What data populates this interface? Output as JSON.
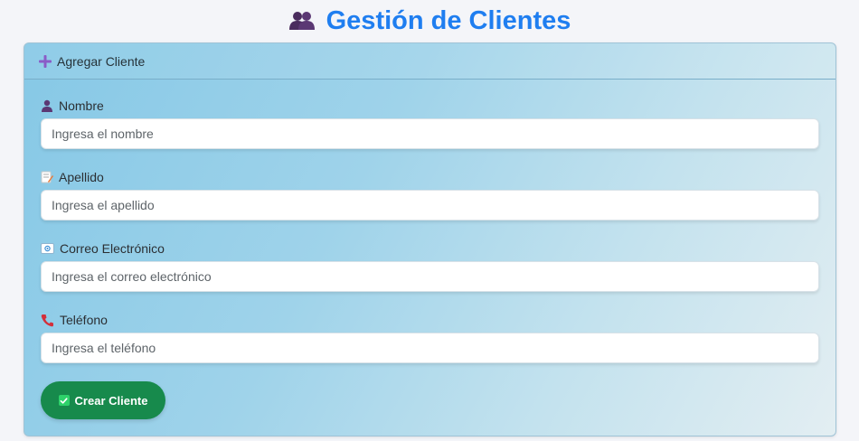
{
  "title": {
    "text": "Gestión de Clientes",
    "icon": "users-icon"
  },
  "card": {
    "header_label": "Agregar Cliente",
    "header_icon": "plus-icon",
    "fields": [
      {
        "label": "Nombre",
        "icon": "person-icon",
        "placeholder": "Ingresa el nombre",
        "value": ""
      },
      {
        "label": "Apellido",
        "icon": "memo-icon",
        "placeholder": "Ingresa el apellido",
        "value": ""
      },
      {
        "label": "Correo Electrónico",
        "icon": "email-icon",
        "placeholder": "Ingresa el correo electrónico",
        "value": ""
      },
      {
        "label": "Teléfono",
        "icon": "phone-icon",
        "placeholder": "Ingresa el teléfono",
        "value": ""
      }
    ],
    "submit_label": "Crear Cliente",
    "submit_icon": "checkmark-icon"
  },
  "colors": {
    "title": "#1f7ef0",
    "submit_bg": "#178a4c",
    "plus": "#8a5cc7"
  }
}
